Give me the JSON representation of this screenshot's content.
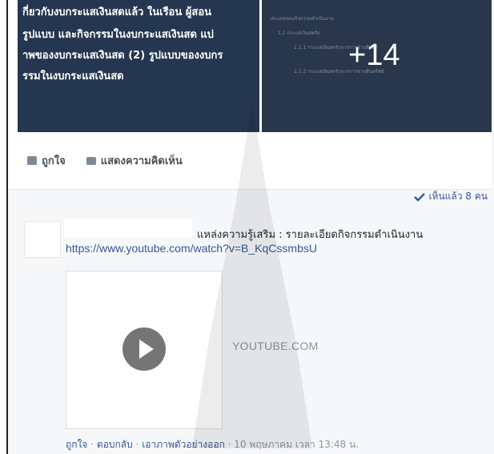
{
  "post": {
    "photo_left_lines": [
      "กี่ยวกับงบกระแสเงินสดแล้ว ในเรือน ผู้สอน",
      "รูปแบบ และกิจกรรมในงบกระแสเงินสด แบ่",
      "าพของงบกระแสเงินสด (2) รูปแบบของงบกร",
      "รรมในงบกระแสเงินสด"
    ],
    "photo_right_lines": [
      "ประเภทของกิจกรรมดำเนินงาน",
      "1.1 กระแสเงินสดรับ",
      "1.1.1 กระแสเงินสดรับจากการขายสินค้า",
      "1.1.2 กระแสเงินสดรับจากการขายสินทรัพย์"
    ],
    "more_photos": "+14"
  },
  "actions": {
    "like_label": "ถูกใจ",
    "comment_label": "แสดงความคิดเห็น"
  },
  "seen_by": "เห็นแล้ว 8 คน",
  "comment": {
    "text": "แหล่งความรู้เสริม : รายละเอียดกิจกรรมดำเนินงาน",
    "link": "https://www.youtube.com/watch?v=B_KqCssmbsU",
    "preview_domain": "YOUTUBE.COM",
    "footer": {
      "like": "ถูกใจ",
      "reply": "ตอบกลับ",
      "remove_preview": "เอาภาพตัวอย่างออก",
      "timestamp": "10 พฤษภาคม เวลา 13:48 น.",
      "separator": " · "
    }
  },
  "icons": {
    "like": "thumbs-up-icon",
    "comment": "comment-icon",
    "seen": "check-icon",
    "play": "play-icon"
  },
  "colors": {
    "link": "#365899",
    "muted": "#90949c",
    "photo_bg": "#243650"
  }
}
